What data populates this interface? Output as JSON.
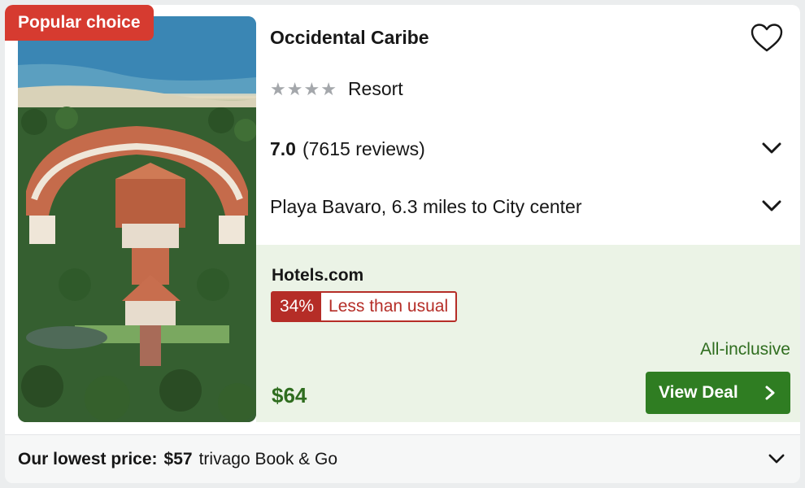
{
  "badge": "Popular choice",
  "hotel": {
    "name": "Occidental Caribe",
    "stars": 4,
    "type": "Resort",
    "rating_score": "7.0",
    "rating_reviews": "(7615 reviews)",
    "location": "Playa Bavaro, 6.3 miles to City center"
  },
  "deal": {
    "provider": "Hotels.com",
    "percent": "34%",
    "comparison": "Less than usual",
    "board": "All-inclusive",
    "price": "$64",
    "button_label": "View Deal"
  },
  "lowest": {
    "label": "Our lowest price:",
    "price": "$57",
    "provider": "trivago Book & Go"
  },
  "icons": {
    "favorite": "heart-icon",
    "expand": "chevron-down-icon",
    "go": "chevron-right-icon"
  },
  "colors": {
    "badge": "#d63b30",
    "deal_bg": "#ebf3e6",
    "price": "#2f6d1f",
    "button": "#2f7d22",
    "discount": "#b52d27"
  }
}
